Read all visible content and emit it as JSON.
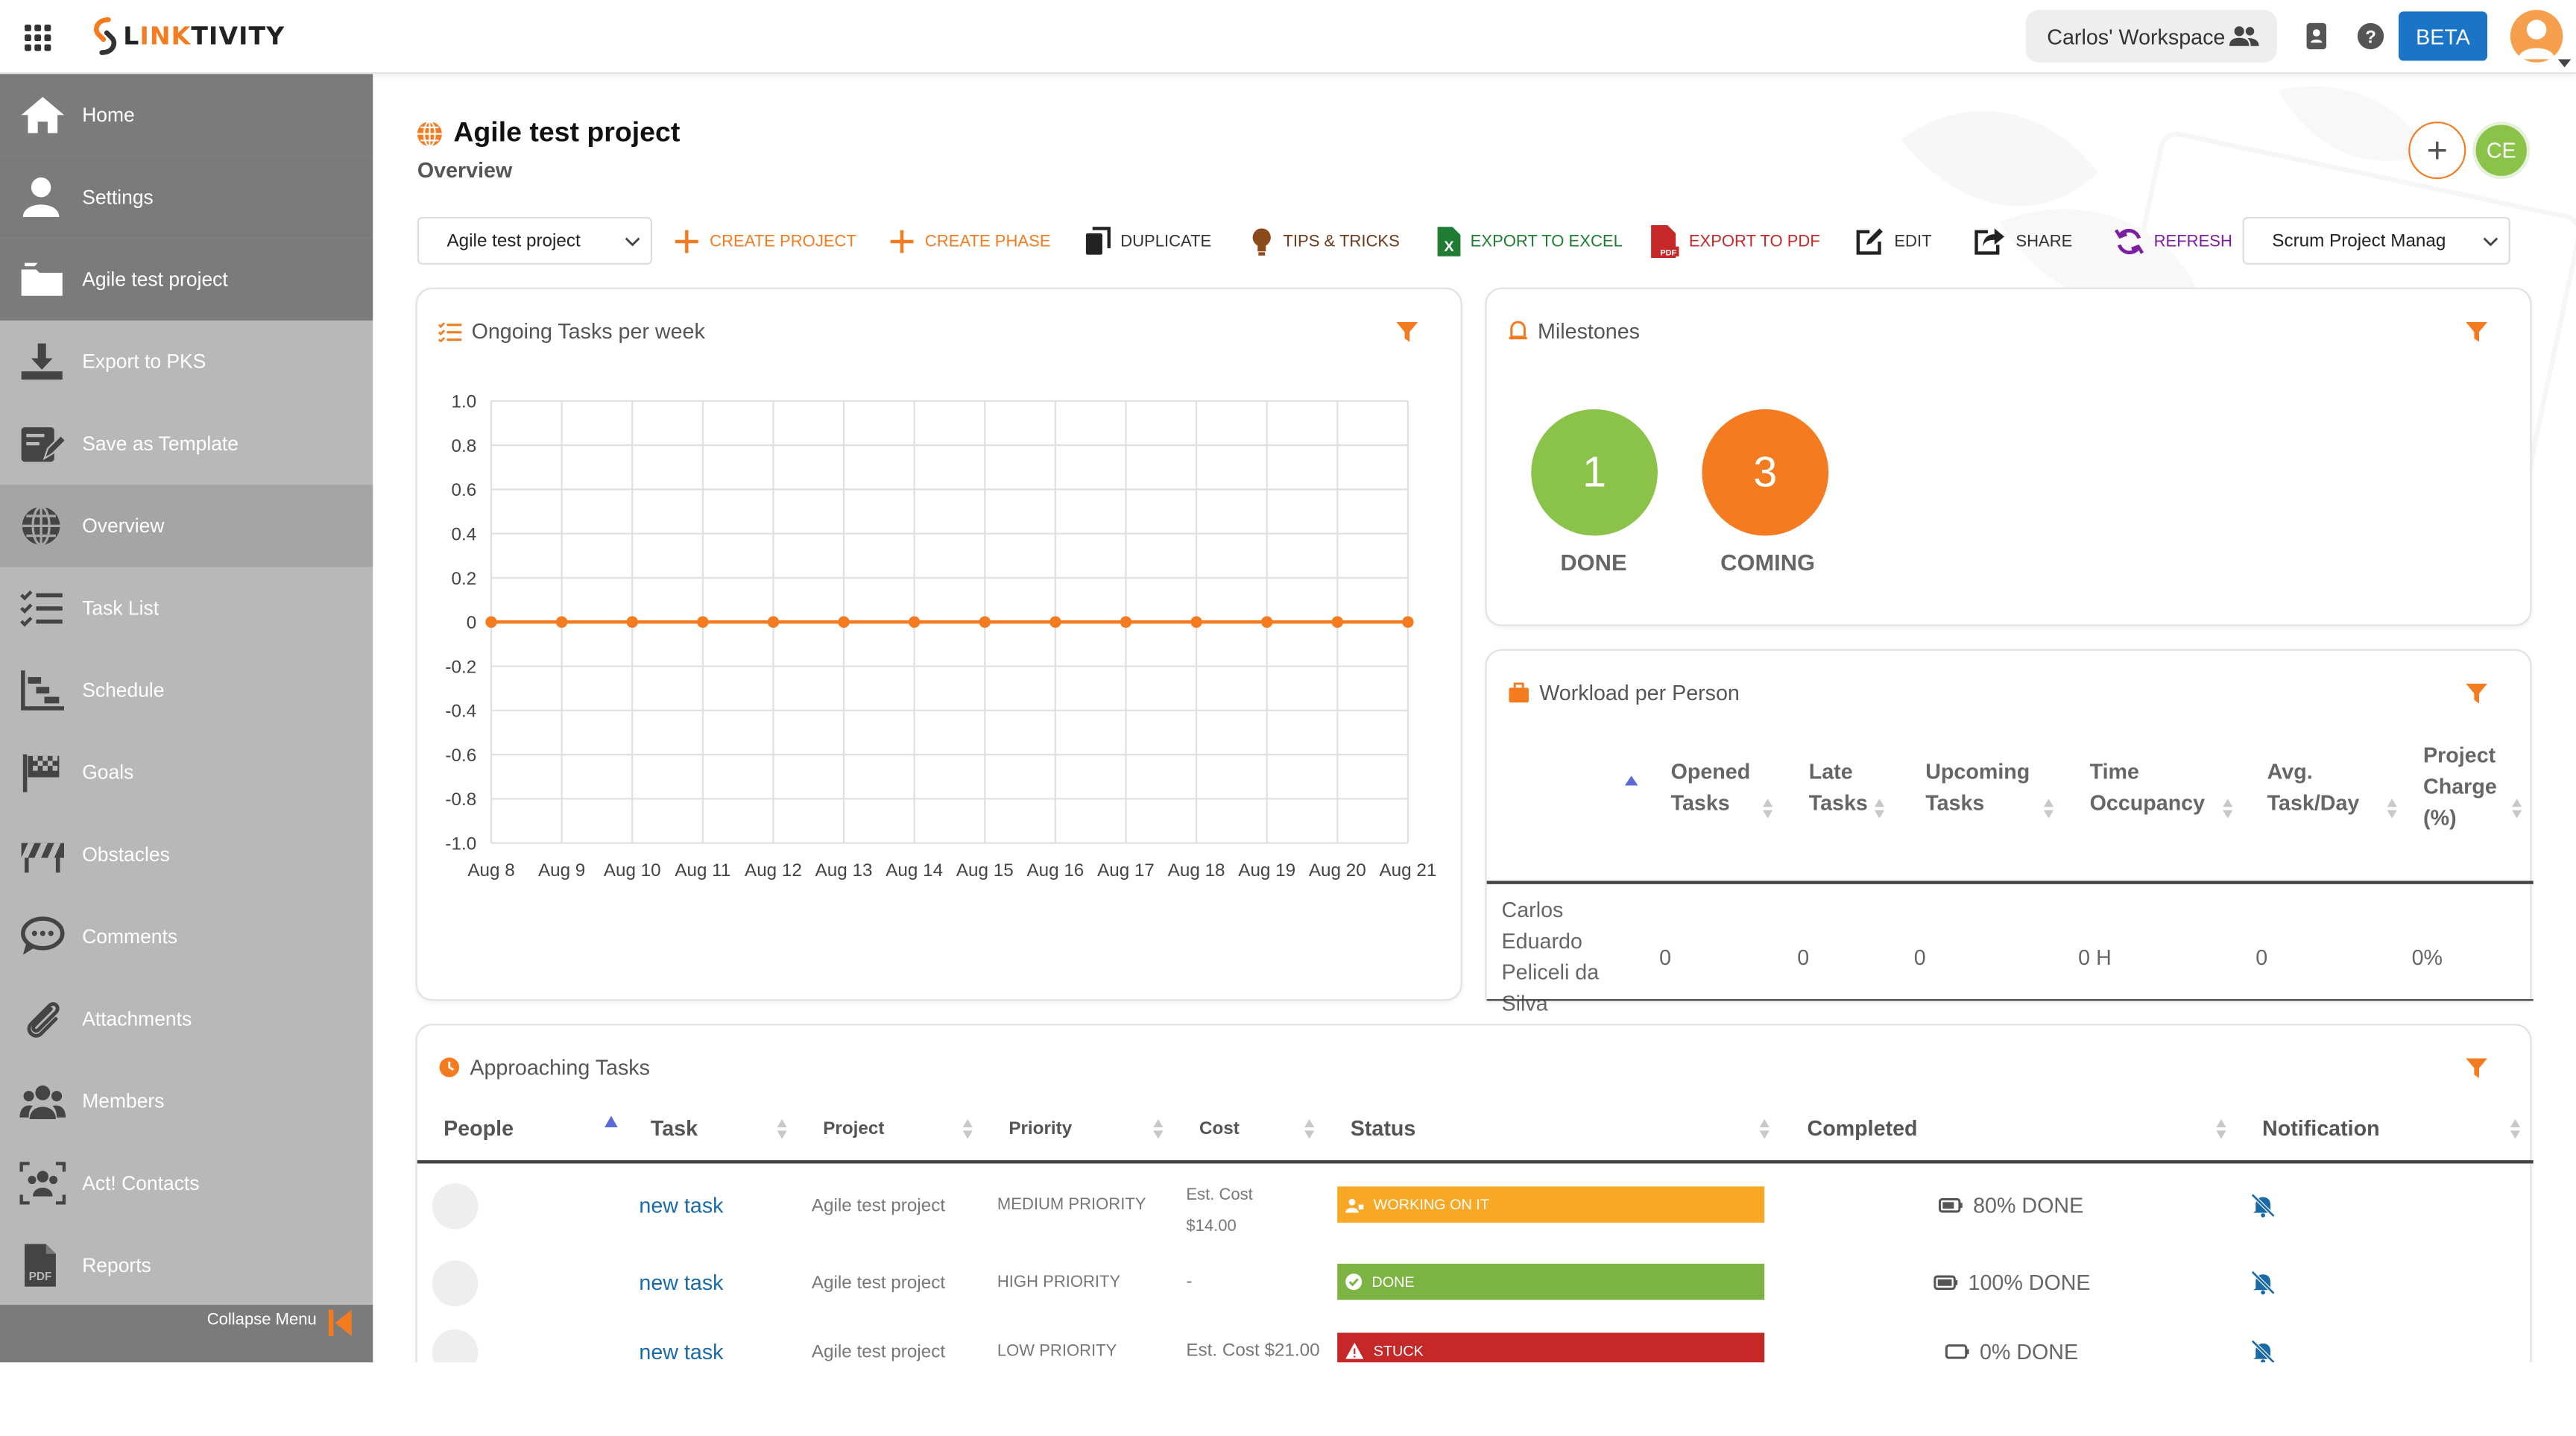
{
  "header": {
    "workspace": "Carlos' Workspace",
    "beta": "BETA"
  },
  "sidebar": {
    "items": [
      {
        "label": "Home",
        "icon": "home-icon"
      },
      {
        "label": "Settings",
        "icon": "user-icon"
      },
      {
        "label": "Agile test project",
        "icon": "folder-icon"
      },
      {
        "label": "Export to PKS",
        "icon": "download-icon"
      },
      {
        "label": "Save as Template",
        "icon": "template-icon"
      },
      {
        "label": "Overview",
        "icon": "globe-icon"
      },
      {
        "label": "Task List",
        "icon": "checklist-icon"
      },
      {
        "label": "Schedule",
        "icon": "gantt-icon"
      },
      {
        "label": "Goals",
        "icon": "flag-icon"
      },
      {
        "label": "Obstacles",
        "icon": "barrier-icon"
      },
      {
        "label": "Comments",
        "icon": "comment-icon"
      },
      {
        "label": "Attachments",
        "icon": "paperclip-icon"
      },
      {
        "label": "Members",
        "icon": "members-icon"
      },
      {
        "label": "Act! Contacts",
        "icon": "contacts-icon"
      },
      {
        "label": "Reports",
        "icon": "pdf-icon"
      }
    ],
    "collapse_label": "Collapse Menu"
  },
  "page": {
    "title": "Agile test project",
    "subtitle": "Overview",
    "avatar_initials": "CE",
    "plus": "+"
  },
  "toolbar": {
    "project_select": "Agile test project",
    "create_project": "CREATE PROJECT",
    "create_phase": "CREATE PHASE",
    "duplicate": "DUPLICATE",
    "tips": "TIPS & TRICKS",
    "export_excel": "EXPORT TO EXCEL",
    "export_pdf": "EXPORT TO PDF",
    "edit": "EDIT",
    "share": "SHARE",
    "refresh": "REFRESH",
    "template_select": "Scrum Project Manag"
  },
  "ongoing": {
    "title": "Ongoing Tasks per week"
  },
  "chart_data": {
    "type": "line",
    "title": "Ongoing Tasks per week",
    "categories": [
      "Aug 8",
      "Aug 9",
      "Aug 10",
      "Aug 11",
      "Aug 12",
      "Aug 13",
      "Aug 14",
      "Aug 15",
      "Aug 16",
      "Aug 17",
      "Aug 18",
      "Aug 19",
      "Aug 20",
      "Aug 21"
    ],
    "series": [
      {
        "values": [
          0,
          0,
          0,
          0,
          0,
          0,
          0,
          0,
          0,
          0,
          0,
          0,
          0,
          0
        ],
        "color": "#f47b20"
      }
    ],
    "ylim": [
      -1.0,
      1.0
    ],
    "yticks": [
      "1.0",
      "0.8",
      "0.6",
      "0.4",
      "0.2",
      "0",
      "-0.2",
      "-0.4",
      "-0.6",
      "-0.8",
      "-1.0"
    ],
    "grid": true
  },
  "milestones": {
    "title": "Milestones",
    "done_count": "1",
    "done_label": "DONE",
    "coming_count": "3",
    "coming_label": "COMING",
    "done_color": "#8bc34a",
    "coming_color": "#f47b20"
  },
  "workload": {
    "title": "Workload per Person",
    "headers": [
      "Opened Tasks",
      "Late Tasks",
      "Upcoming Tasks",
      "Time Occupancy",
      "Avg. Task/Day",
      "Project Charge (%)"
    ],
    "row": {
      "name": "Carlos Eduardo Peliceli da Silva",
      "values": [
        "0",
        "0",
        "0",
        "0 H",
        "0",
        "0%"
      ]
    }
  },
  "approaching": {
    "title": "Approaching Tasks",
    "headers": {
      "people": "People",
      "task": "Task",
      "project": "Project",
      "priority": "Priority",
      "cost": "Cost",
      "status": "Status",
      "completed": "Completed",
      "notification": "Notification"
    },
    "rows": [
      {
        "task": "new task",
        "project": "Agile test project",
        "priority": "MEDIUM PRIORITY",
        "cost": "Est. Cost $14.00",
        "status": "WORKING ON IT",
        "status_color": "#f9a825",
        "completed": "80% DONE",
        "progress": 0.8
      },
      {
        "task": "new task",
        "project": "Agile test project",
        "priority": "HIGH PRIORITY",
        "cost": "-",
        "status": "DONE",
        "status_color": "#7cb342",
        "completed": "100% DONE",
        "progress": 1.0
      },
      {
        "task": "new task",
        "project": "Agile test project",
        "priority": "LOW PRIORITY",
        "cost": "Est. Cost $21.00",
        "status": "STUCK",
        "status_color": "#c62828",
        "completed": "0% DONE",
        "progress": 0.0
      }
    ]
  }
}
